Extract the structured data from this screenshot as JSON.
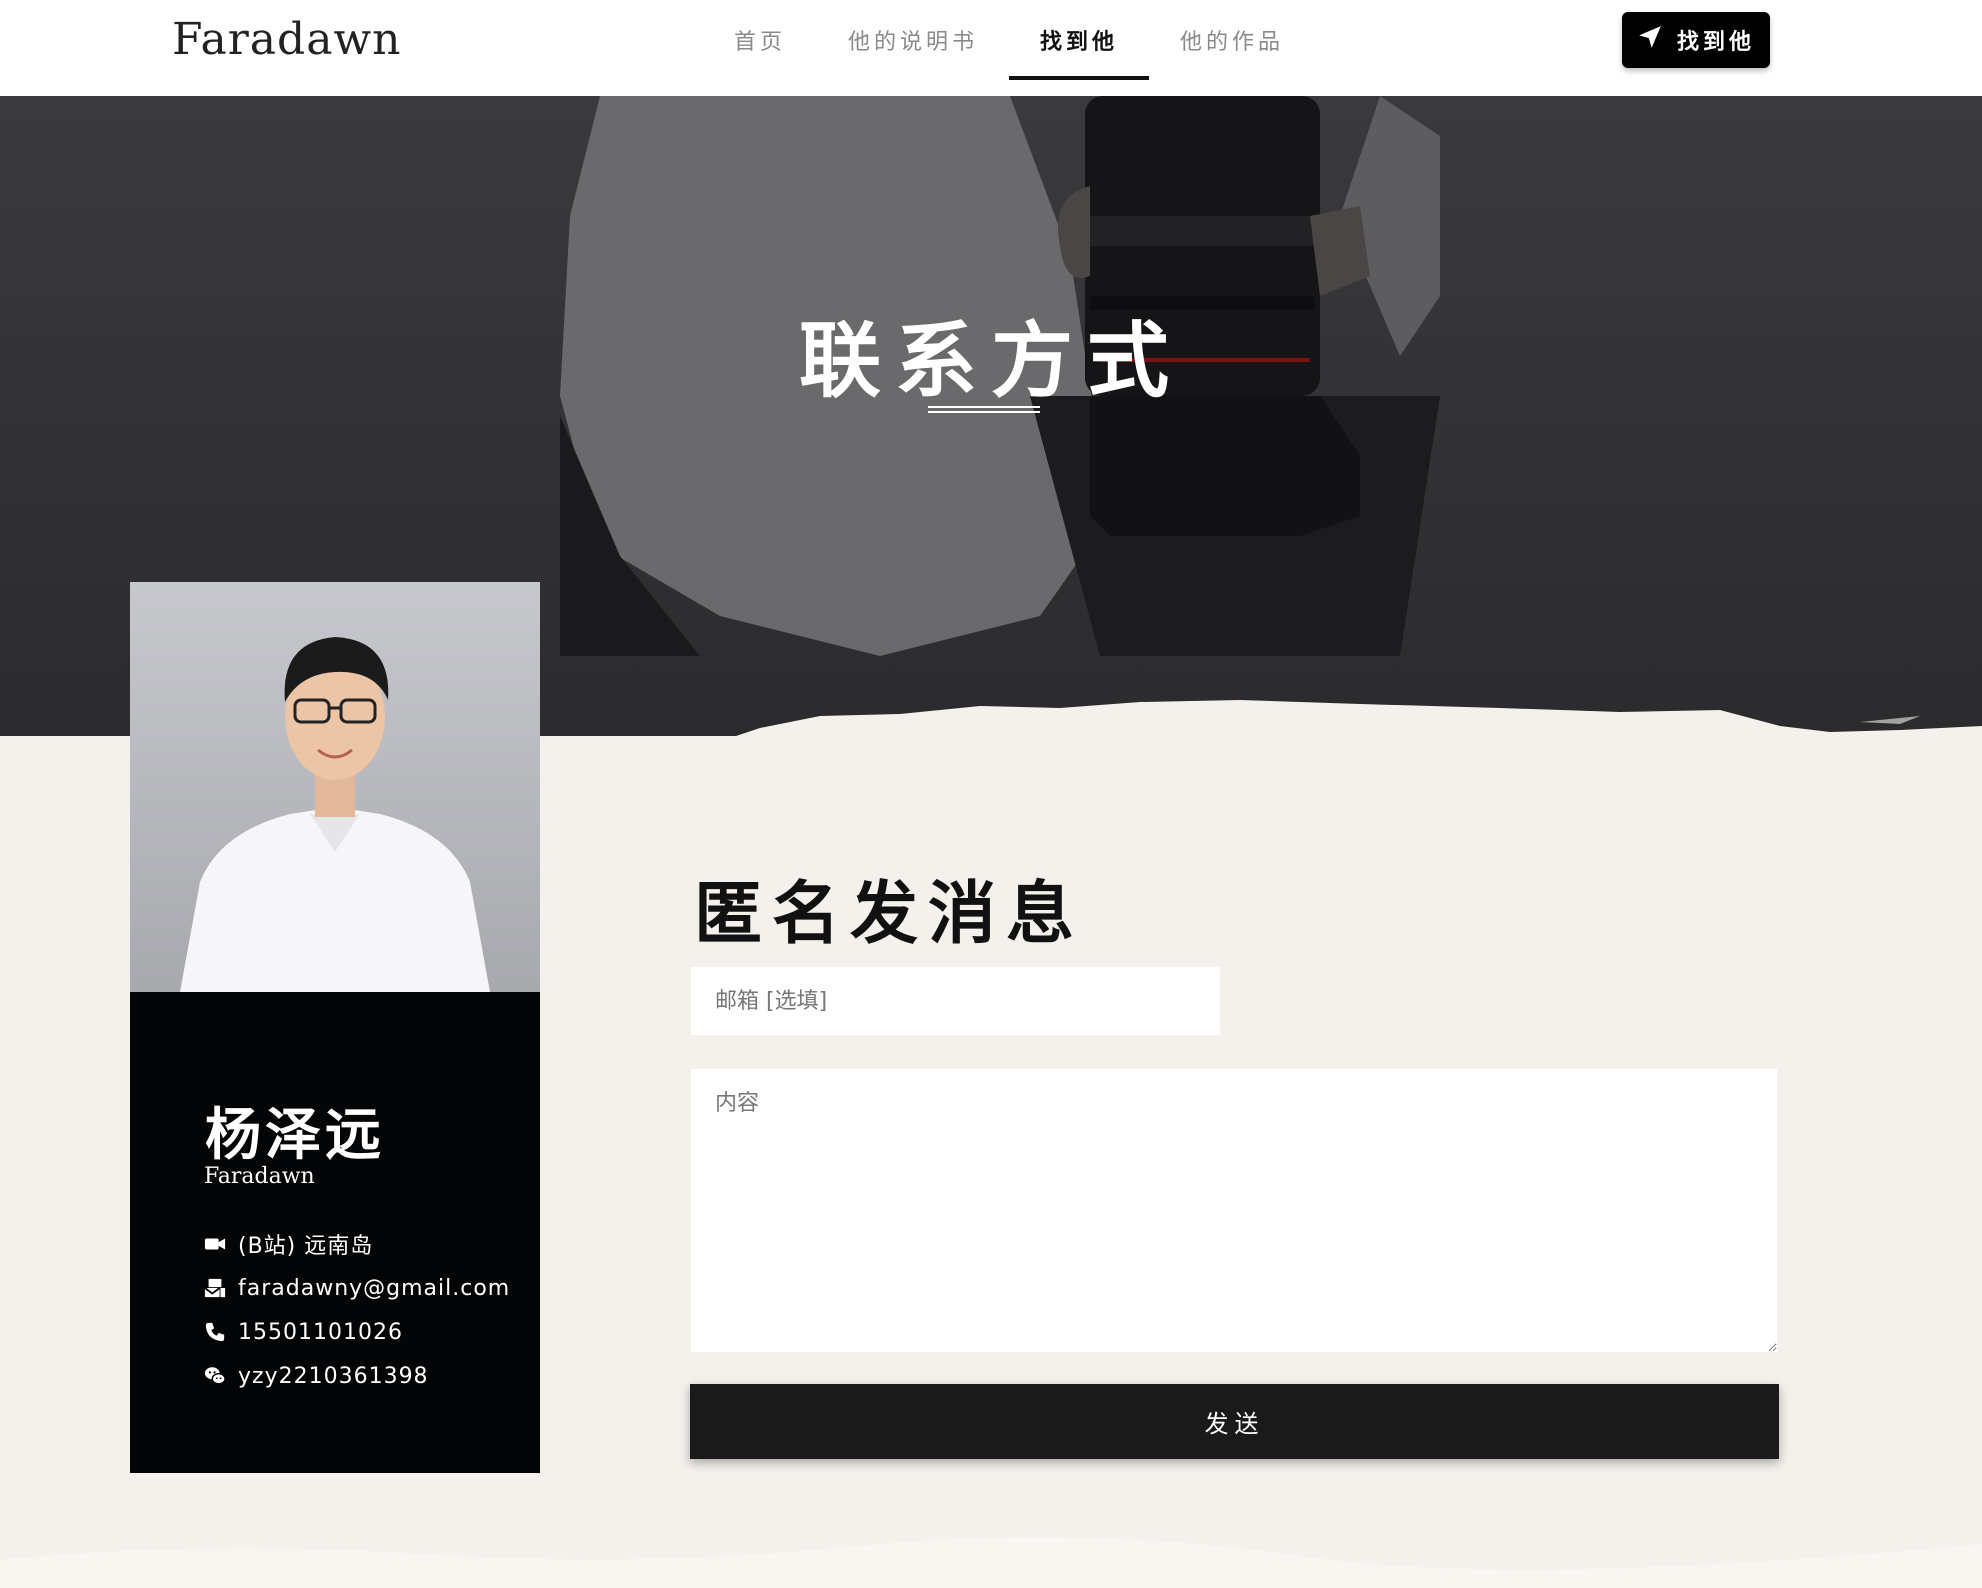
{
  "header": {
    "brand": "Faradawn",
    "nav": [
      {
        "label": "首页",
        "active": false
      },
      {
        "label": "他的说明书",
        "active": false
      },
      {
        "label": "找到他",
        "active": true
      },
      {
        "label": "他的作品",
        "active": false
      }
    ],
    "cta_label": "找到他",
    "cta_icon": "location-arrow-icon"
  },
  "hero": {
    "title": "联系方式"
  },
  "profile": {
    "name": "杨泽远",
    "alias": "Faradawn",
    "contacts": [
      {
        "icon": "video-camera-icon",
        "text": "(B站) 远南岛"
      },
      {
        "icon": "mail-bulk-icon",
        "text": "faradawny@gmail.com"
      },
      {
        "icon": "phone-icon",
        "text": "15501101026"
      },
      {
        "icon": "wechat-icon",
        "text": "yzy2210361398"
      }
    ]
  },
  "form": {
    "title": "匿名发消息",
    "email_placeholder": "邮箱 [选填]",
    "email_value": "",
    "content_placeholder": "内容",
    "content_value": "",
    "send_label": "发送"
  },
  "colors": {
    "background": "#f4f1ec",
    "header_bg": "#ffffff",
    "hero_bg": "#323234",
    "card_bg": "#040507",
    "button_bg": "#1a1a1a",
    "accent": "#000000"
  }
}
